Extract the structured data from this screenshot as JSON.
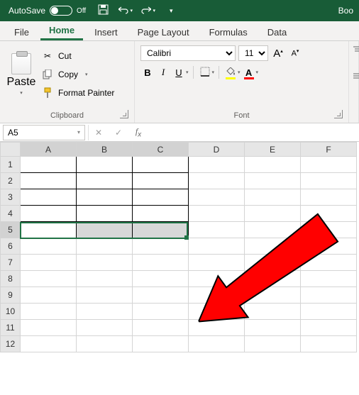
{
  "titlebar": {
    "autosave_label": "AutoSave",
    "autosave_state": "Off",
    "doc_title": "Boo"
  },
  "tabs": [
    "File",
    "Home",
    "Insert",
    "Page Layout",
    "Formulas",
    "Data"
  ],
  "active_tab": 1,
  "clipboard": {
    "paste": "Paste",
    "cut": "Cut",
    "copy": "Copy",
    "format_painter": "Format Painter",
    "group": "Clipboard"
  },
  "font": {
    "name": "Calibri",
    "size": "11",
    "bold": "B",
    "italic": "I",
    "underline": "U",
    "group": "Font",
    "grow": "A",
    "shrink": "A",
    "fill_color": "#ffff00",
    "font_color": "#ff0000"
  },
  "namebox": "A5",
  "columns": [
    "A",
    "B",
    "C",
    "D",
    "E",
    "F"
  ],
  "rows": [
    1,
    2,
    3,
    4,
    5,
    6,
    7,
    8,
    9,
    10,
    11,
    12
  ],
  "bordered_range": {
    "r1": 1,
    "r2": 5,
    "c1": 1,
    "c2": 3
  },
  "selected_row": 5,
  "active_cell": {
    "r": 5,
    "c": 1
  }
}
